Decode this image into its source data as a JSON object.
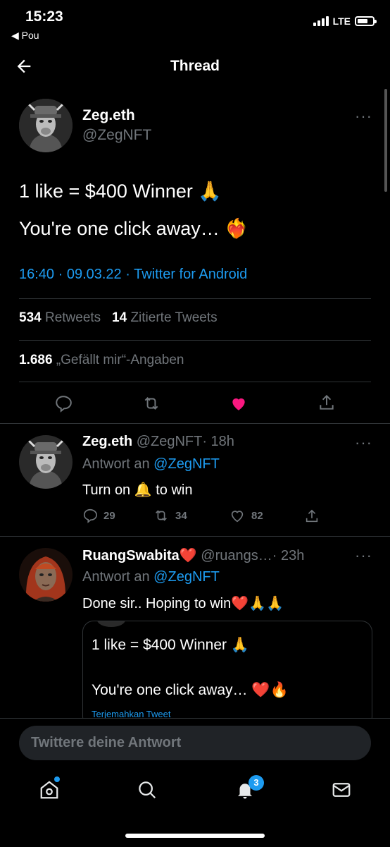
{
  "status": {
    "time": "15:23",
    "back_app": "◀ Pou",
    "network": "LTE"
  },
  "header": {
    "title": "Thread"
  },
  "main_tweet": {
    "name": "Zeg.eth",
    "handle": "@ZegNFT",
    "line1": "1 like = $400 Winner",
    "line1_emoji": "🙏",
    "line2": "You're one click away…",
    "line2_emoji": "❤️‍🔥",
    "timestamp": "16:40 · 09.03.22",
    "source": "· Twitter for Android",
    "retweets_count": "534",
    "retweets_label": "Retweets",
    "quotes_count": "14",
    "quotes_label": "Zitierte Tweets",
    "likes_count": "1.686",
    "likes_label": "„Gefällt mir“-Angaben"
  },
  "replies": [
    {
      "name": "Zeg.eth",
      "handle": "@ZegNFT",
      "time": "· 18h",
      "reply_to_prefix": "Antwort an",
      "reply_to": "@ZegNFT",
      "text_before": "Turn on",
      "emoji": "🔔",
      "text_after": "to win",
      "replies": "29",
      "retweets": "34",
      "likes": "82"
    },
    {
      "name": "RuangSwabita",
      "name_emoji": "❤️",
      "handle": "@ruangs…",
      "time": "· 23h",
      "reply_to_prefix": "Antwort an",
      "reply_to": "@ZegNFT",
      "text": "Done sir.. Hoping to win",
      "text_emoji": "❤️🙏🙏",
      "quoted": {
        "line1": "1 like = $400 Winner",
        "line1_emoji": "🙏",
        "line2": "You're one click away…",
        "line2_emoji": "❤️🔥",
        "translate": "Terjemahkan Tweet"
      }
    }
  ],
  "composer": {
    "placeholder": "Twittere deine Antwort"
  },
  "tabbar": {
    "notifications_badge": "3"
  },
  "colors": {
    "accent": "#1d9bf0",
    "like": "#f91880",
    "background": "#000000"
  }
}
